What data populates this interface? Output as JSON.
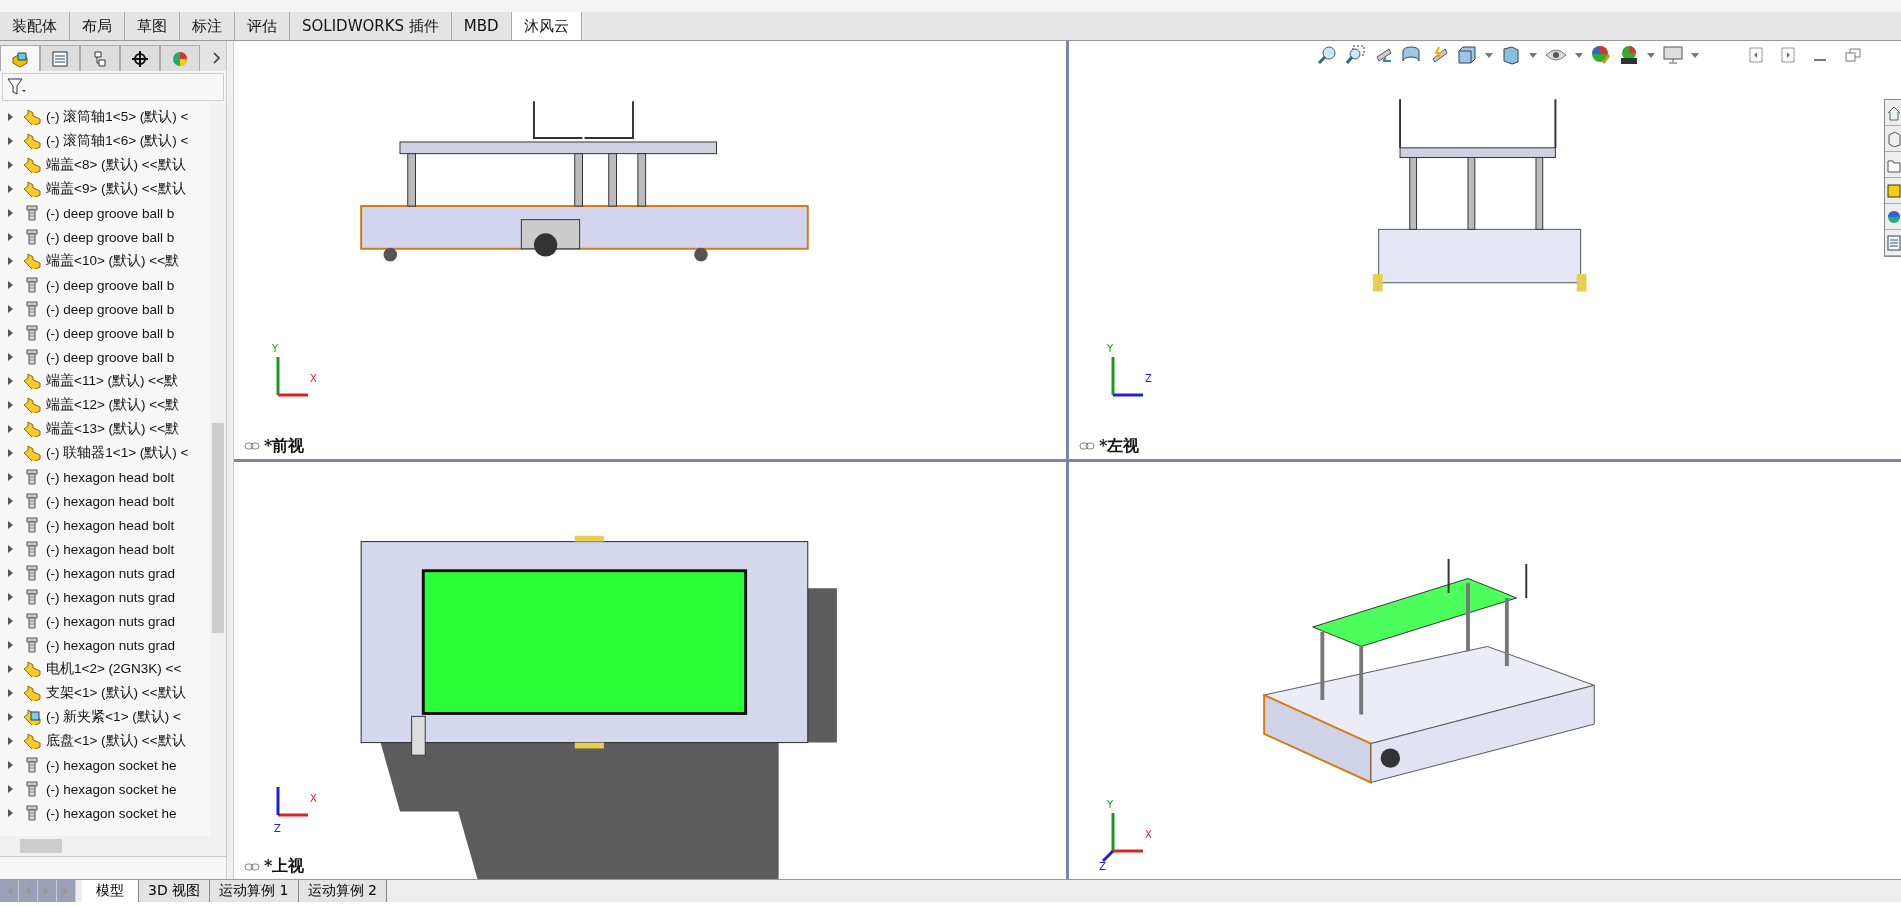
{
  "command_tabs": [
    {
      "label": "装配体",
      "selected": false
    },
    {
      "label": "布局",
      "selected": false
    },
    {
      "label": "草图",
      "selected": false
    },
    {
      "label": "标注",
      "selected": false
    },
    {
      "label": "评估",
      "selected": false
    },
    {
      "label": "SOLIDWORKS 插件",
      "selected": false
    },
    {
      "label": "MBD",
      "selected": false
    },
    {
      "label": "沐风云",
      "selected": true
    }
  ],
  "panel_tabs": [
    {
      "kind": "tree",
      "selected": true
    },
    {
      "kind": "property",
      "selected": false
    },
    {
      "kind": "config",
      "selected": false
    },
    {
      "kind": "dimxpert",
      "selected": false
    },
    {
      "kind": "display",
      "selected": false
    }
  ],
  "feature_tree": [
    {
      "kind": "part",
      "label": "(-) 滚筒轴1<5> (默认) <"
    },
    {
      "kind": "part",
      "label": "(-) 滚筒轴1<6> (默认) <"
    },
    {
      "kind": "part",
      "label": "端盖<8> (默认) <<默认"
    },
    {
      "kind": "part",
      "label": "端盖<9> (默认) <<默认"
    },
    {
      "kind": "toolbox",
      "label": "(-) deep groove ball b"
    },
    {
      "kind": "toolbox",
      "label": "(-) deep groove ball b"
    },
    {
      "kind": "part",
      "label": "端盖<10> (默认) <<默"
    },
    {
      "kind": "toolbox",
      "label": "(-) deep groove ball b"
    },
    {
      "kind": "toolbox",
      "label": "(-) deep groove ball b"
    },
    {
      "kind": "toolbox",
      "label": "(-) deep groove ball b"
    },
    {
      "kind": "toolbox",
      "label": "(-) deep groove ball b"
    },
    {
      "kind": "part",
      "label": "端盖<11> (默认) <<默"
    },
    {
      "kind": "part",
      "label": "端盖<12> (默认) <<默"
    },
    {
      "kind": "part",
      "label": "端盖<13> (默认) <<默"
    },
    {
      "kind": "part",
      "label": "(-) 联轴器1<1> (默认) <"
    },
    {
      "kind": "toolbox",
      "label": "(-) hexagon head bolt"
    },
    {
      "kind": "toolbox",
      "label": "(-) hexagon head bolt"
    },
    {
      "kind": "toolbox",
      "label": "(-) hexagon head bolt"
    },
    {
      "kind": "toolbox",
      "label": "(-) hexagon head bolt"
    },
    {
      "kind": "toolbox",
      "label": "(-) hexagon nuts grad"
    },
    {
      "kind": "toolbox",
      "label": "(-) hexagon nuts grad"
    },
    {
      "kind": "toolbox",
      "label": "(-) hexagon nuts grad"
    },
    {
      "kind": "toolbox",
      "label": "(-) hexagon nuts grad"
    },
    {
      "kind": "part",
      "label": "电机1<2> (2GN3K) <<"
    },
    {
      "kind": "part",
      "label": "支架<1> (默认) <<默认"
    },
    {
      "kind": "assembly",
      "label": "(-) 新夹紧<1> (默认) <"
    },
    {
      "kind": "part",
      "label": "底盘<1> (默认) <<默认"
    },
    {
      "kind": "toolbox",
      "label": "(-) hexagon socket he"
    },
    {
      "kind": "toolbox",
      "label": "(-) hexagon socket he"
    },
    {
      "kind": "toolbox",
      "label": "(-) hexagon socket he"
    }
  ],
  "viewports": [
    {
      "kind": "front",
      "label": "*前视",
      "axes": [
        "Y",
        "X"
      ]
    },
    {
      "kind": "left",
      "label": "*左视",
      "axes": [
        "Y",
        "Z"
      ]
    },
    {
      "kind": "top",
      "label": "*上视",
      "axes": [
        "X",
        "Z"
      ]
    },
    {
      "kind": "iso",
      "axes": [
        "Y",
        "X",
        "Z"
      ]
    }
  ],
  "bottom_tabs": [
    {
      "label": "模型",
      "selected": true
    },
    {
      "label": "3D 视图",
      "selected": false
    },
    {
      "label": "运动算例 1",
      "selected": false
    },
    {
      "label": "运动算例 2",
      "selected": false
    }
  ]
}
